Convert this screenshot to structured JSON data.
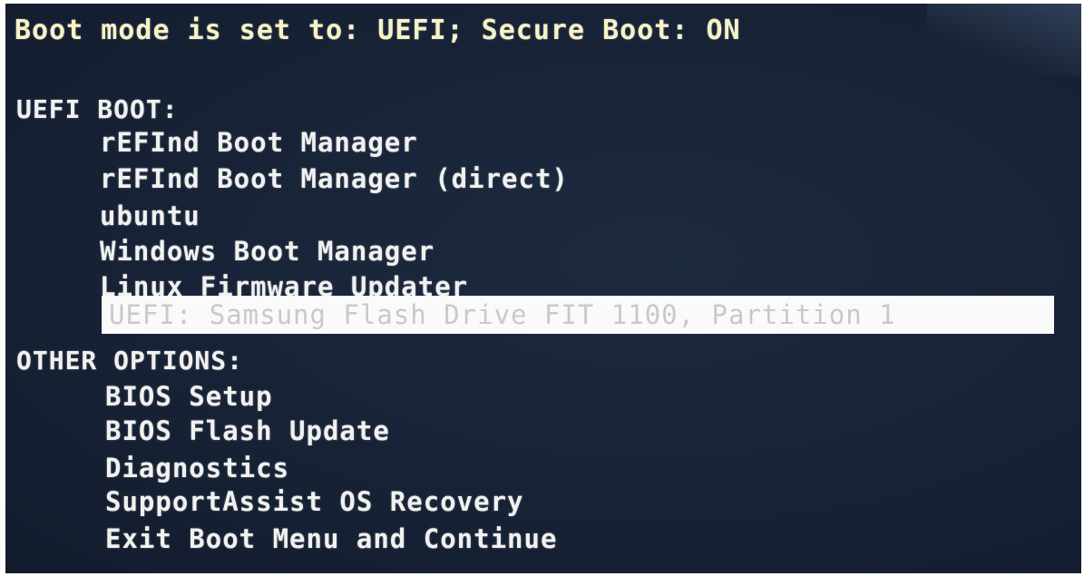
{
  "status_line": "Boot mode is set to: UEFI; Secure Boot: ON",
  "uefi_boot": {
    "header": "UEFI BOOT:",
    "items": [
      "rEFInd Boot Manager",
      "rEFInd Boot Manager (direct)",
      "ubuntu",
      "Windows Boot Manager",
      "Linux Firmware Updater",
      "UEFI: Samsung Flash Drive FIT 1100, Partition 1"
    ],
    "selected_index": 5
  },
  "other_options": {
    "header": "OTHER OPTIONS:",
    "items": [
      "BIOS Setup",
      "BIOS Flash Update",
      "Diagnostics",
      "SupportAssist OS Recovery",
      "Exit Boot Menu and Continue"
    ]
  },
  "colors": {
    "background": "#172236",
    "text": "#f1f1ef",
    "status_text": "#f6f3c6",
    "selection_bg": "#fafafa",
    "selection_text": "#c9c9c9"
  }
}
